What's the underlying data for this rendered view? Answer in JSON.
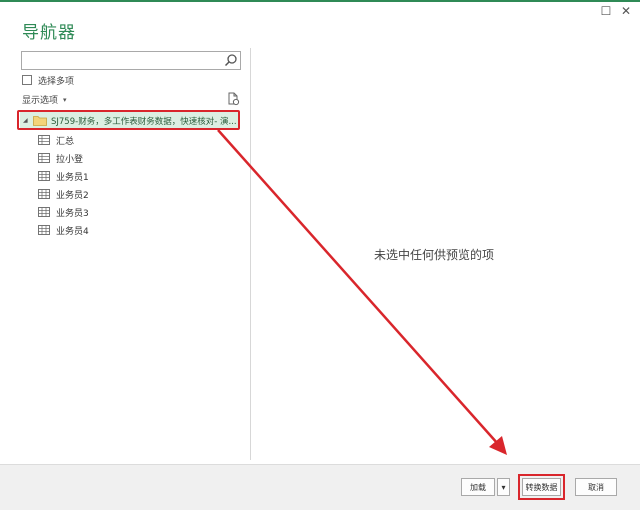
{
  "window": {
    "title": "导航器",
    "maximize_glyph": "☐",
    "close_glyph": "✕"
  },
  "search": {
    "placeholder": "",
    "value": ""
  },
  "options": {
    "multi_select_label": "选择多项",
    "display_options_label": "显示选项",
    "caret_glyph": "▾"
  },
  "tree": {
    "expand_glyph": "◢",
    "root_label": "SJ759-财务，多工作表财务数据，快速核对- 演...",
    "items": [
      {
        "label": "汇总"
      },
      {
        "label": "拉小登"
      },
      {
        "label": "业务员1"
      },
      {
        "label": "业务员2"
      },
      {
        "label": "业务员3"
      },
      {
        "label": "业务员4"
      }
    ]
  },
  "preview": {
    "empty_message": "未选中任何供预览的项"
  },
  "footer": {
    "load_label": "加载",
    "load_dropdown_glyph": "▾",
    "transform_label": "转换数据",
    "cancel_label": "取消"
  },
  "colors": {
    "accent_green": "#2f8a56",
    "highlight_red": "#d9262c",
    "selection_bg": "#dcefe2"
  },
  "icons": {
    "search": "search-icon",
    "refresh": "refresh-icon",
    "folder": "folder-icon",
    "table": "table-icon"
  }
}
